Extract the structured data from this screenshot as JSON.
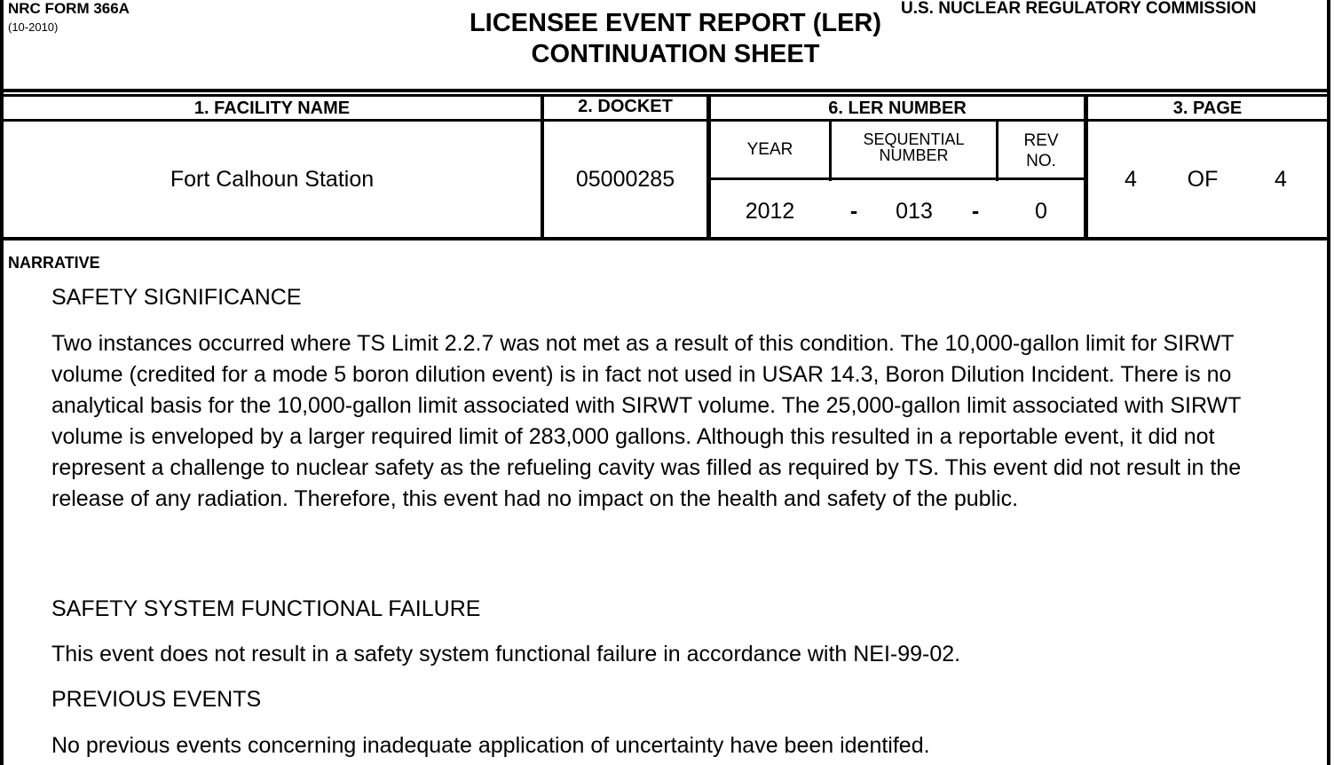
{
  "header": {
    "form_number": "NRC FORM 366A",
    "form_date": "(10-2010)",
    "title_line1": "LICENSEE EVENT REPORT (LER)",
    "title_line2": "CONTINUATION SHEET",
    "agency": "U.S. NUCLEAR REGULATORY COMMISSION"
  },
  "table": {
    "facility_label": "1. FACILITY NAME",
    "docket_label": "2. DOCKET",
    "ler_label": "6. LER NUMBER",
    "page_label": "3. PAGE",
    "year_label": "YEAR",
    "seq_label_line1": "SEQUENTIAL",
    "seq_label_line2": "NUMBER",
    "rev_label_line1": "REV",
    "rev_label_line2": "NO.",
    "facility_name": "Fort Calhoun Station",
    "docket": "05000285",
    "year": "2012",
    "dash": "-",
    "sequential": "013",
    "rev": "0",
    "page_current": "4",
    "page_of": "OF",
    "page_total": "4"
  },
  "narrative": {
    "label": "NARRATIVE",
    "heading1": "SAFETY SIGNIFICANCE",
    "para1": "Two instances occurred where TS Limit 2.2.7 was not met as a result of this condition.  The 10,000-gallon limit for SIRWT volume (credited for a mode 5 boron dilution event) is in fact not used in USAR 14.3, Boron Dilution Incident.  There is no analytical basis for the 10,000-gallon limit associated with SIRWT volume.  The 25,000-gallon limit associated with SIRWT volume is enveloped by a larger required limit of 283,000 gallons.  Although this resulted in a reportable event, it did not represent a challenge to nuclear safety as the refueling cavity was filled as required by TS.  This event did not result in the release of any radiation.  Therefore, this event had no impact on the health and safety of the public.",
    "heading2": "SAFETY SYSTEM FUNCTIONAL FAILURE",
    "para2": "This event does not result in a safety system functional failure in accordance with NEI-99-02.",
    "heading3": "PREVIOUS EVENTS",
    "para3": "No previous events concerning inadequate application of uncertainty have been identifed."
  }
}
